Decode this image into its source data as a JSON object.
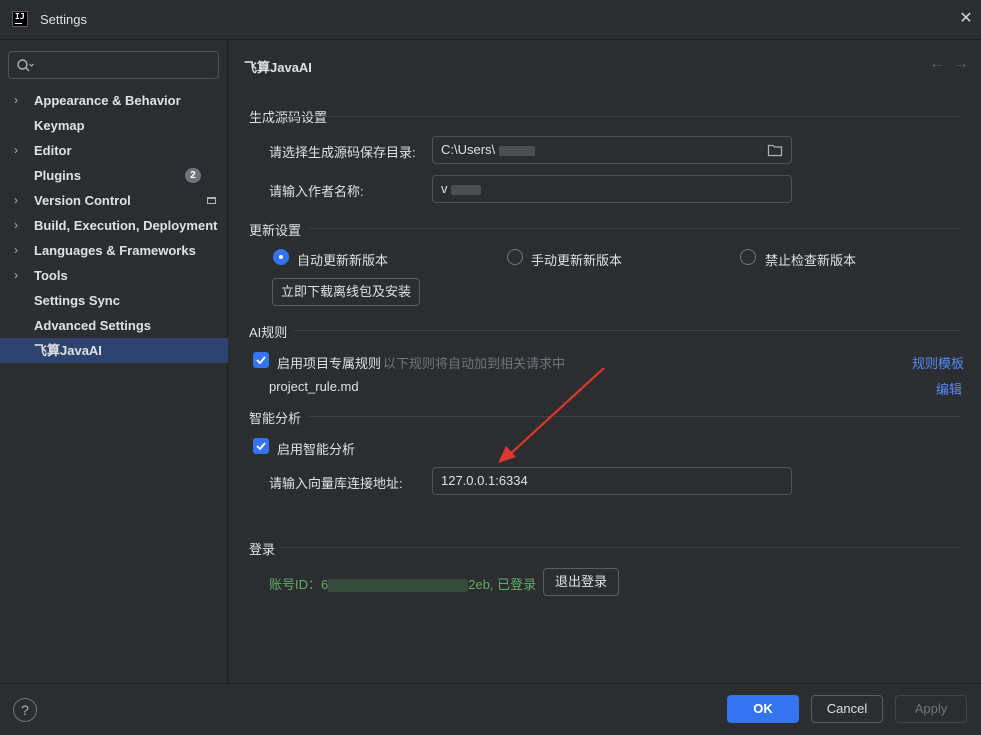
{
  "window": {
    "title": "Settings"
  },
  "search": {
    "placeholder": ""
  },
  "sidebar": {
    "items": [
      {
        "label": "Appearance & Behavior"
      },
      {
        "label": "Keymap"
      },
      {
        "label": "Editor"
      },
      {
        "label": "Plugins",
        "badge": "2"
      },
      {
        "label": "Version Control"
      },
      {
        "label": "Build, Execution, Deployment"
      },
      {
        "label": "Languages & Frameworks"
      },
      {
        "label": "Tools"
      },
      {
        "label": "Settings Sync"
      },
      {
        "label": "Advanced Settings"
      },
      {
        "label": "飞算JavaAI",
        "selected": true
      }
    ]
  },
  "page": {
    "title": "飞算JavaAI",
    "back_icon": "arrow-left-icon",
    "forward_icon": "arrow-right-icon"
  },
  "source_gen": {
    "section_title": "生成源码设置",
    "dir_label": "请选择生成源码保存目录:",
    "dir_value": "C:\\Users\\",
    "author_label": "请输入作者名称:",
    "author_value": "v"
  },
  "update": {
    "section_title": "更新设置",
    "options": [
      "自动更新新版本",
      "手动更新新版本",
      "禁止检查新版本"
    ],
    "selected_index": 0,
    "download_button": "立即下载离线包及安装"
  },
  "ai_rules": {
    "section_title": "AI规则",
    "enable_label": "启用项目专属规则",
    "enable_checked": true,
    "hint": "以下规则将自动加到相关请求中",
    "template_link": "规则模板",
    "rule_file": "project_rule.md",
    "edit_link": "编辑"
  },
  "analysis": {
    "section_title": "智能分析",
    "enable_label": "启用智能分析",
    "enable_checked": true,
    "address_label": "请输入向量库连接地址:",
    "address_value": "127.0.0.1:6334"
  },
  "login": {
    "section_title": "登录",
    "account_prefix": "账号ID：6",
    "account_suffix": "2eb, 已登录",
    "logout_button": "退出登录"
  },
  "footer": {
    "help": "?",
    "ok": "OK",
    "cancel": "Cancel",
    "apply": "Apply"
  },
  "colors": {
    "accent": "#3574f0",
    "link": "#548af7",
    "success": "#5fad65",
    "annotation_arrow": "#e0352b"
  }
}
